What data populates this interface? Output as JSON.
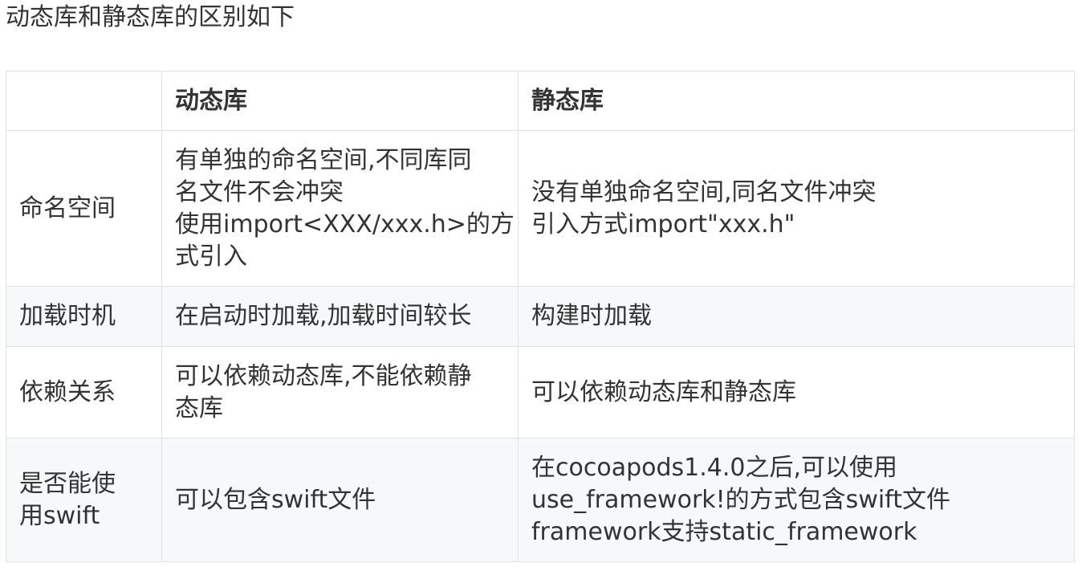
{
  "title": "动态库和静态库的区别如下",
  "table": {
    "headers": [
      "",
      "动态库",
      "静态库"
    ],
    "rows": [
      {
        "label": [
          "命名空间"
        ],
        "dynamic": [
          "有单独的命名空间,不同库同",
          "名文件不会冲突",
          "使用import<XXX/xxx.h>的方",
          "式引入"
        ],
        "static": [
          "没有单独命名空间,同名文件冲突",
          "引入方式import\"xxx.h\""
        ]
      },
      {
        "label": [
          "加载时机"
        ],
        "dynamic": [
          "在启动时加载,加载时间较长"
        ],
        "static": [
          "构建时加载"
        ]
      },
      {
        "label": [
          "依赖关系"
        ],
        "dynamic": [
          "可以依赖动态库,不能依赖静",
          "态库"
        ],
        "static": [
          "可以依赖动态库和静态库"
        ]
      },
      {
        "label": [
          "是否能使",
          "用swift"
        ],
        "dynamic": [
          "可以包含swift文件"
        ],
        "static": [
          "在cocoapods1.4.0之后,可以使用",
          "use_framework!的方式包含swift文件",
          "framework支持static_framework"
        ]
      }
    ]
  }
}
